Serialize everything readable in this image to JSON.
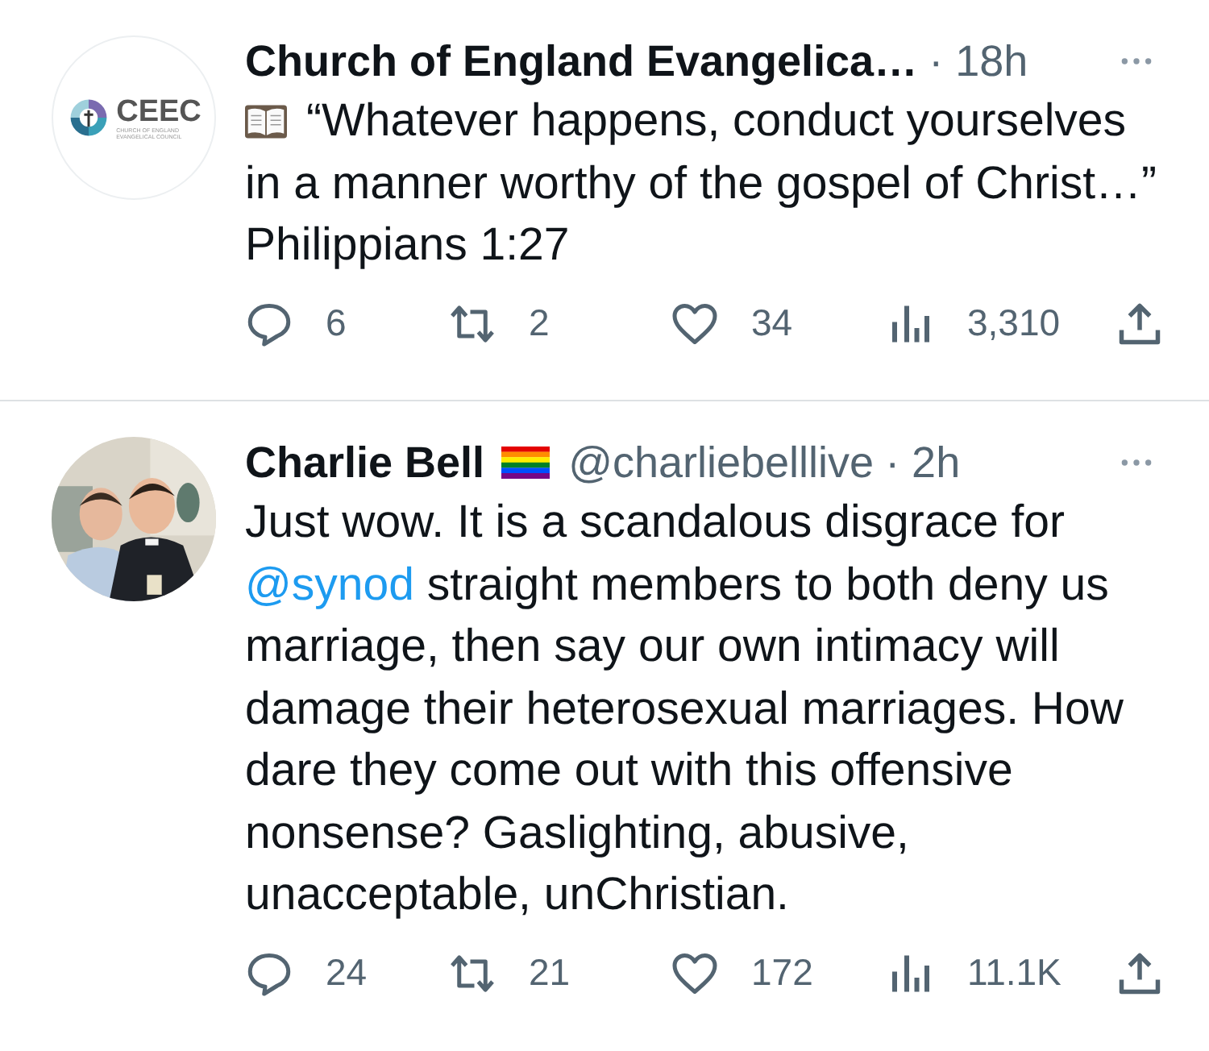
{
  "tweets": [
    {
      "avatar": {
        "kind": "logo",
        "wordmark": "CEEC",
        "subtitle": [
          "CHURCH OF ENGLAND",
          "EVANGELICAL COUNCIL"
        ]
      },
      "name": "Church of England Evangelica…",
      "time": "· 18h",
      "body": [
        {
          "kind": "book_icon"
        },
        {
          "kind": "text",
          "text": "“Whatever happens, conduct yourselves in a manner worthy of the gospel of Christ…” Philippians 1:27"
        }
      ],
      "replies": "6",
      "retweets": "2",
      "likes": "34",
      "views": "3,310"
    },
    {
      "name": "Charlie Bell",
      "name_badge": {
        "kind": "rainbow_flag"
      },
      "handle": "@charliebelllive",
      "time": "· 2h",
      "body": [
        {
          "kind": "text",
          "text": "Just wow. It is a scandalous disgrace for "
        },
        {
          "kind": "mention",
          "text": "@synod"
        },
        {
          "kind": "text",
          "text": " straight members to both deny us marriage, then say our own intimacy will damage their heterosexual marriages. How dare they come out with this offensive nonsense? Gaslighting, abusive, unacceptable, unChristian."
        }
      ],
      "replies": "24",
      "retweets": "21",
      "likes": "172",
      "views": "11.1K"
    }
  ]
}
